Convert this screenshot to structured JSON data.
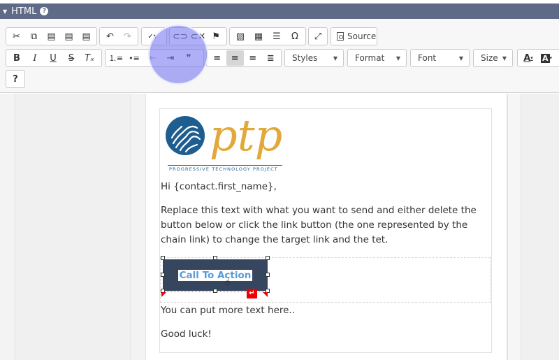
{
  "panel": {
    "title": "HTML"
  },
  "toolbar": {
    "row1_group1": [
      {
        "icon": "cut-icon",
        "glyph": "✂"
      },
      {
        "icon": "copy-icon",
        "glyph": "⧉"
      },
      {
        "icon": "paste-icon",
        "glyph": "📋"
      },
      {
        "icon": "paste-text-icon",
        "glyph": "📄"
      },
      {
        "icon": "paste-word-icon",
        "glyph": "📑"
      }
    ],
    "row1_group2": [
      {
        "icon": "undo-icon",
        "glyph": "↶"
      },
      {
        "icon": "redo-icon",
        "glyph": "↷"
      }
    ],
    "spellcheck": {
      "icon": "spellcheck-icon",
      "glyph": "ᴬᴮᶜ✓▾"
    },
    "row1_group4": [
      {
        "icon": "link-icon",
        "glyph": "🔗"
      },
      {
        "icon": "unlink-icon",
        "glyph": "⛓"
      },
      {
        "icon": "anchor-flag-icon",
        "glyph": "⚑"
      }
    ],
    "row1_group5": [
      {
        "icon": "image-icon",
        "glyph": "🖼"
      },
      {
        "icon": "table-icon",
        "glyph": "▦"
      },
      {
        "icon": "horizontal-line-icon",
        "glyph": "☰"
      },
      {
        "icon": "special-char-icon",
        "glyph": "Ω"
      }
    ],
    "maximize": {
      "icon": "maximize-icon",
      "glyph": "⤢"
    },
    "source_label": "Source",
    "row2_group1": [
      {
        "icon": "bold-icon",
        "glyph": "B"
      },
      {
        "icon": "italic-icon",
        "glyph": "I"
      },
      {
        "icon": "underline-icon",
        "glyph": "U"
      },
      {
        "icon": "strike-icon",
        "glyph": "S"
      },
      {
        "icon": "remove-format-icon",
        "glyph": "Tₓ"
      }
    ],
    "row2_group2": [
      {
        "icon": "numbered-list-icon",
        "glyph": "⒈"
      },
      {
        "icon": "bulleted-list-icon",
        "glyph": "•≡"
      },
      {
        "icon": "outdent-icon",
        "glyph": "⇤"
      },
      {
        "icon": "indent-icon",
        "glyph": "⇥"
      },
      {
        "icon": "blockquote-icon",
        "glyph": "❞"
      }
    ],
    "row2_group3": [
      {
        "icon": "align-left-icon",
        "glyph": "≡"
      },
      {
        "icon": "align-center-icon",
        "glyph": "≡"
      },
      {
        "icon": "align-right-icon",
        "glyph": "≡"
      },
      {
        "icon": "justify-icon",
        "glyph": "≣"
      }
    ],
    "combos": {
      "styles": "Styles",
      "format": "Format",
      "font": "Font",
      "size": "Size"
    },
    "text_color": "A",
    "bg_color": "A",
    "help": "?"
  },
  "email": {
    "logo_text": "ptp",
    "logo_tagline": "PROGRESSIVE TECHNOLOGY PROJECT",
    "greeting": "Hi {contact.first_name},",
    "paragraph1": "Replace this text with what you want to send and either delete the button below or click the link button (the one represented by the chain link) to change the target link and the tet.",
    "cta_label": "Call To Action",
    "paragraph2": "You can put more text here..",
    "closing": "Good luck!"
  },
  "colors": {
    "header_bg": "#5f6a86",
    "cta_bg": "#37465f",
    "cta_text": "#5b9bd5",
    "logo_orange": "#e2a93a",
    "logo_blue": "#1d5d8f",
    "highlight": "#6e6ef0"
  }
}
